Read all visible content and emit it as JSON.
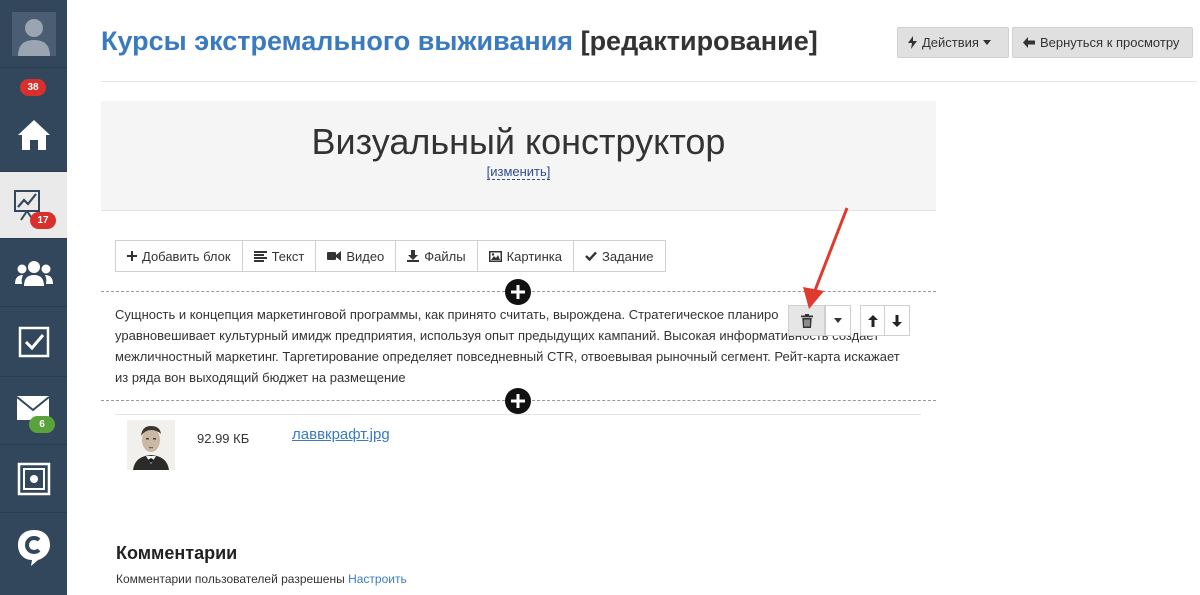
{
  "sidebar": {
    "items": [
      {
        "icon": "user-avatar-icon"
      },
      {
        "icon": "home-icon",
        "badge": "38",
        "badge_color": "#d9302c"
      },
      {
        "icon": "presentation-chart-icon",
        "badge": "17",
        "badge_color": "#d9302c",
        "active": true
      },
      {
        "icon": "users-group-icon"
      },
      {
        "icon": "checkbox-icon"
      },
      {
        "icon": "mail-icon",
        "badge": "6",
        "badge_color": "#5aa33a"
      },
      {
        "icon": "safe-icon"
      },
      {
        "icon": "brand-logo-icon"
      }
    ]
  },
  "header": {
    "course_name": "Курсы экстремального выживания",
    "mode_label": "[редактирование]",
    "actions_label": "Действия",
    "back_label": "Вернуться к просмотру"
  },
  "heading": {
    "title": "Визуальный конструктор",
    "edit_link": "[изменить]"
  },
  "toolbar": {
    "add_block": "Добавить блок",
    "text": "Текст",
    "video": "Видео",
    "files": "Файлы",
    "image": "Картинка",
    "task": "Задание"
  },
  "text_block": {
    "line1": "Сущность и концепция маркетинговой программы, как принято считать, вырождена. Стратегическое планиро",
    "line2": "уравновешивает культурный имидж предприятия, используя опыт предыдущих кампаний. Высокая информативность создает",
    "line3": "межличностный маркетинг. Таргетирование определяет повседневный CTR, отвоевывая рыночный сегмент. Рейт-карта искажает",
    "line4": "из ряда вон выходящий бюджет на размещение"
  },
  "file": {
    "size": "92.99 КБ",
    "name": "лаввкрафт.jpg"
  },
  "comments": {
    "title": "Комментарии",
    "status": "Комментарии пользователей разрешены",
    "configure_link": "Настроить"
  },
  "colors": {
    "sidebar_bg": "#33475c",
    "link": "#3a7bbf",
    "arrow": "#e03a2f"
  }
}
